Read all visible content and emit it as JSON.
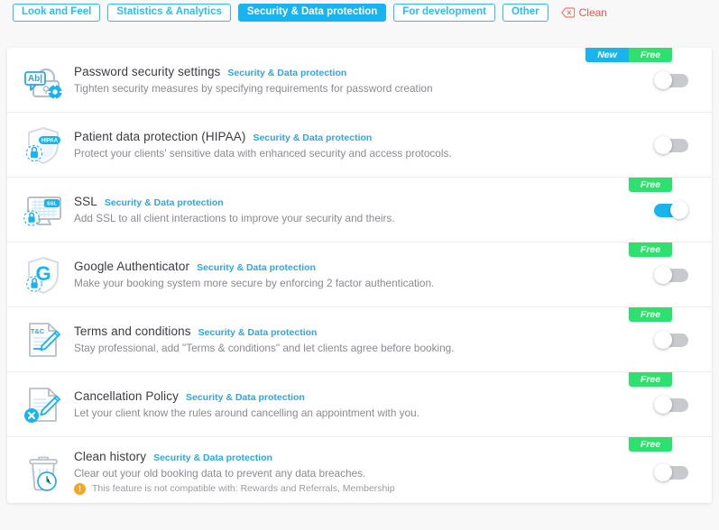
{
  "tabs": [
    {
      "label": "Look and Feel",
      "active": false
    },
    {
      "label": "Statistics & Analytics",
      "active": false
    },
    {
      "label": "Security & Data protection",
      "active": true
    },
    {
      "label": "For development",
      "active": false
    },
    {
      "label": "Other",
      "active": false
    }
  ],
  "clean": {
    "label": "Clean",
    "icon": "backspace-delete-icon",
    "color": "#f0564a"
  },
  "colors": {
    "accent_blue": "#18b4f0",
    "badge_new": "#18b4f0",
    "badge_free": "#2ee06d",
    "warning_orange": "#f5a623",
    "clean_red": "#f0564a",
    "page_bg": "#f8f8f9",
    "card_bg": "#ffffff"
  },
  "features": [
    {
      "icon": "password-lock-icon",
      "title": "Password security settings",
      "category": "Security & Data protection",
      "description": "Tighten security measures by specifying requirements for password creation",
      "badges": [
        "New",
        "Free"
      ],
      "toggle_on": false,
      "warning": null
    },
    {
      "icon": "hipaa-shield-icon",
      "title": "Patient data protection (HIPAA)",
      "category": "Security & Data protection",
      "description": "Protect your clients' sensitive data with enhanced security and access protocols.",
      "badges": [],
      "toggle_on": false,
      "warning": null
    },
    {
      "icon": "ssl-monitor-icon",
      "title": "SSL",
      "category": "Security & Data protection",
      "description": "Add SSL to all client interactions to improve your security and theirs.",
      "badges": [
        "Free"
      ],
      "toggle_on": true,
      "warning": null
    },
    {
      "icon": "google-authenticator-shield-icon",
      "title": "Google Authenticator",
      "category": "Security & Data protection",
      "description": "Make your booking system more secure by enforcing 2 factor authentication.",
      "badges": [
        "Free"
      ],
      "toggle_on": false,
      "warning": null
    },
    {
      "icon": "terms-document-pencil-icon",
      "title": "Terms and conditions",
      "category": "Security & Data protection",
      "description": "Stay professional, add \"Terms & conditions\" and let clients agree before booking.",
      "badges": [
        "Free"
      ],
      "toggle_on": false,
      "warning": null
    },
    {
      "icon": "cancellation-document-x-icon",
      "title": "Cancellation Policy",
      "category": "Security & Data protection",
      "description": "Let your client know the rules around cancelling an appointment with you.",
      "badges": [
        "Free"
      ],
      "toggle_on": false,
      "warning": null
    },
    {
      "icon": "trash-clock-icon",
      "title": "Clean history",
      "category": "Security & Data protection",
      "description": "Clear out your old booking data to prevent any data breaches.",
      "badges": [
        "Free"
      ],
      "toggle_on": false,
      "warning": "This feature is not compatible with: Rewards and Referrals, Membership"
    }
  ]
}
